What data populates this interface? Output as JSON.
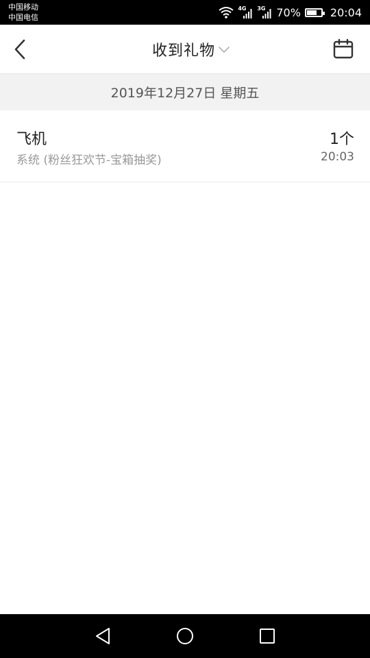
{
  "status_bar": {
    "carrier_1": "中国移动",
    "carrier_2": "中国电信",
    "network_1": "4G",
    "network_2": "3G",
    "battery_percent": "70%",
    "battery_level": 0.7,
    "time": "20:04",
    "icons": [
      "wifi-icon",
      "signal-icon",
      "signal-icon",
      "battery-icon"
    ]
  },
  "header": {
    "title": "收到礼物",
    "back_icon": "chevron-left-icon",
    "dropdown_icon": "chevron-down-icon",
    "calendar_icon": "calendar-icon"
  },
  "date_bar": {
    "date": "2019年12月27日 星期五"
  },
  "gifts": [
    {
      "name": "飞机",
      "source": "系统 (粉丝狂欢节-宝箱抽奖)",
      "count": "1个",
      "time": "20:03"
    }
  ],
  "nav_bar": {
    "icons": [
      "nav-back-icon",
      "nav-home-icon",
      "nav-recents-icon"
    ]
  },
  "colors": {
    "status_bar_bg": "#000000",
    "header_bg": "#ffffff",
    "date_bar_bg": "#f2f2f2",
    "primary_text": "#222222",
    "secondary_text": "#999999"
  }
}
